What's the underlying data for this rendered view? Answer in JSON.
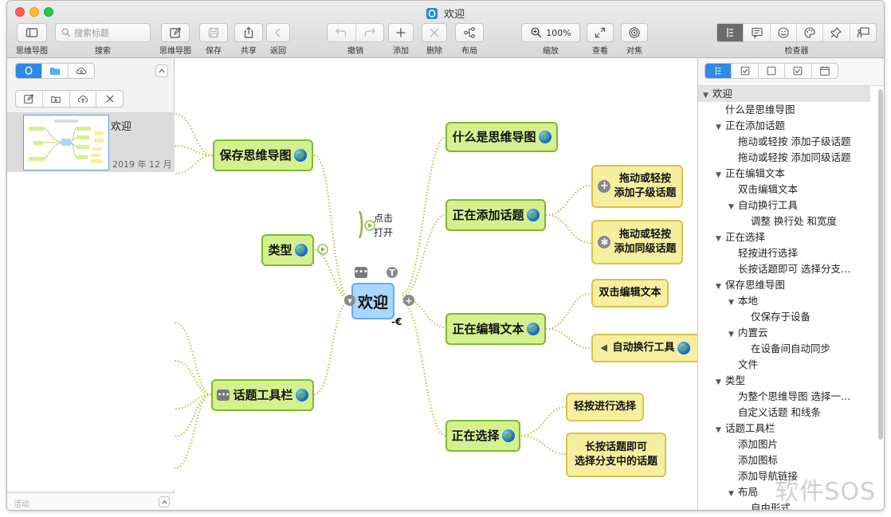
{
  "window": {
    "title": "欢迎",
    "traffic_colors": [
      "#fe5f57",
      "#febc2e",
      "#28c840"
    ]
  },
  "toolbar": {
    "mindmaps_label": "思维导图",
    "search_label": "搜索",
    "search_placeholder": "搜索标题",
    "mindmap_label": "思维导图",
    "save_label": "保存",
    "share_label": "共享",
    "back_label": "返回",
    "undo_label": "撤销",
    "add_label": "添加",
    "delete_label": "删除",
    "layout_label": "布局",
    "zoom_label": "缩放",
    "zoom_value": "100%",
    "view_label": "查看",
    "focus_label": "对焦",
    "inspector_label": "检查器"
  },
  "sidebar": {
    "file_name": "欢迎",
    "file_date": "2019 年 12 月 12",
    "activity": "活动"
  },
  "canvas": {
    "root": "欢迎",
    "click_open": [
      "点击",
      "打开"
    ],
    "nodes": {
      "what_is": "什么是思维导图",
      "adding": "正在添加话题",
      "drag_child_1": "拖动或轻按",
      "drag_child_2": "添加子级话题",
      "drag_sib_1": "拖动或轻按",
      "drag_sib_2": "添加同级话题",
      "editing": "正在编辑文本",
      "double_click": "双击编辑文本",
      "auto_wrap": "自动换行工具",
      "selecting": "正在选择",
      "tap_select": "轻按进行选择",
      "long_1": "长按话题即可",
      "long_2": "选择分支中的话题",
      "save": "保存思维导图",
      "type": "类型",
      "toolbar": "话题工具栏"
    }
  },
  "outline": {
    "rows": [
      {
        "text": "欢迎",
        "level": 0,
        "tri": "▼",
        "selected": true
      },
      {
        "text": "什么是思维导图",
        "level": 1,
        "tri": ""
      },
      {
        "text": "正在添加话题",
        "level": 1,
        "tri": "▼"
      },
      {
        "text": "拖动或轻按 添加子级话题",
        "level": 2,
        "tri": ""
      },
      {
        "text": "拖动或轻按 添加同级话题",
        "level": 2,
        "tri": ""
      },
      {
        "text": "正在编辑文本",
        "level": 1,
        "tri": "▼"
      },
      {
        "text": "双击编辑文本",
        "level": 2,
        "tri": ""
      },
      {
        "text": "自动换行工具",
        "level": 2,
        "tri": "▼"
      },
      {
        "text": "调整 换行处 和宽度",
        "level": 3,
        "tri": ""
      },
      {
        "text": "正在选择",
        "level": 1,
        "tri": "▼"
      },
      {
        "text": "轻按进行选择",
        "level": 2,
        "tri": ""
      },
      {
        "text": "长按话题即可 选择分支…",
        "level": 2,
        "tri": ""
      },
      {
        "text": "保存思维导图",
        "level": 1,
        "tri": "▼"
      },
      {
        "text": "本地",
        "level": 2,
        "tri": "▼"
      },
      {
        "text": "仅保存于设备",
        "level": 3,
        "tri": ""
      },
      {
        "text": "内置云",
        "level": 2,
        "tri": "▼"
      },
      {
        "text": "在设备间自动同步",
        "level": 3,
        "tri": ""
      },
      {
        "text": "文件",
        "level": 2,
        "tri": ""
      },
      {
        "text": "类型",
        "level": 1,
        "tri": "▼"
      },
      {
        "text": "为整个思维导图 选择一…",
        "level": 2,
        "tri": ""
      },
      {
        "text": "自定义话题 和线条",
        "level": 2,
        "tri": ""
      },
      {
        "text": "话题工具栏",
        "level": 1,
        "tri": "▼"
      },
      {
        "text": "添加图片",
        "level": 2,
        "tri": ""
      },
      {
        "text": "添加图标",
        "level": 2,
        "tri": ""
      },
      {
        "text": "添加导航链接",
        "level": 2,
        "tri": ""
      },
      {
        "text": "布局",
        "level": 2,
        "tri": "▼"
      },
      {
        "text": "自由形式",
        "level": 3,
        "tri": ""
      }
    ]
  },
  "watermark": "软件SOS"
}
